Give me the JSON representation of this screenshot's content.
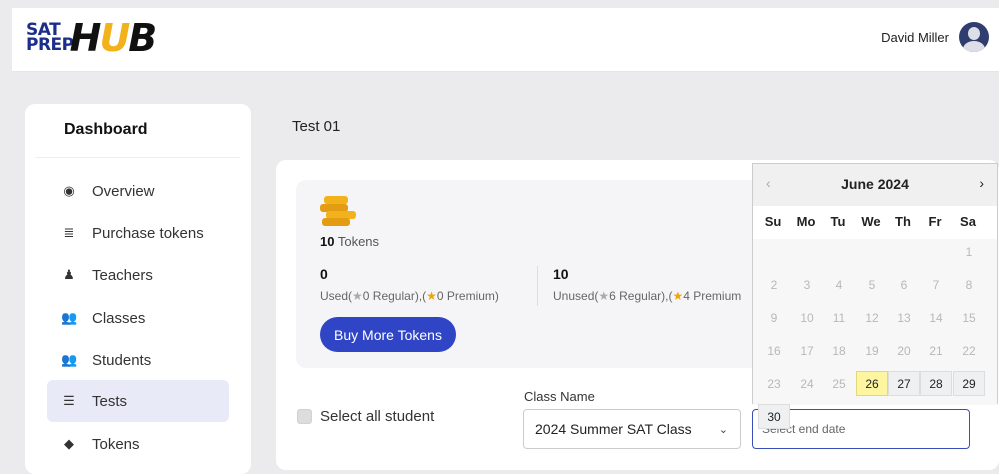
{
  "header": {
    "logo_sat": "SAT",
    "logo_prep": "PREP",
    "logo_h": "H",
    "logo_u": "U",
    "logo_b": "B",
    "user_name": "David Miller"
  },
  "sidebar": {
    "title": "Dashboard",
    "items": [
      {
        "label": "Overview",
        "icon": "eye-icon",
        "glyph": "◉"
      },
      {
        "label": "Purchase tokens",
        "icon": "coins-icon",
        "glyph": "≣"
      },
      {
        "label": "Teachers",
        "icon": "teacher-icon",
        "glyph": "♟"
      },
      {
        "label": "Classes",
        "icon": "users-icon",
        "glyph": "👥"
      },
      {
        "label": "Students",
        "icon": "users-icon",
        "glyph": "👥"
      },
      {
        "label": "Tests",
        "icon": "list-icon",
        "glyph": "☰"
      },
      {
        "label": "Tokens",
        "icon": "tag-icon",
        "glyph": "◆"
      }
    ],
    "active_index": 5
  },
  "breadcrumb": "Test 01",
  "tokens": {
    "count": "10",
    "count_label": " Tokens",
    "used_value": "0",
    "used_prefix": "Used(",
    "used_regular": "0 Regular),(",
    "used_premium": "0 Premium)",
    "unused_value": "10",
    "unused_prefix": "Unused(",
    "unused_regular": "6 Regular),(",
    "unused_premium": "4 Premium",
    "buy_label": "Buy More Tokens"
  },
  "form": {
    "select_all_label": "Select all student",
    "class_label": "Class Name",
    "class_value": "2024 Summer SAT Class",
    "date_placeholder": "Select end date"
  },
  "calendar": {
    "month_title": "June 2024",
    "prev": "‹",
    "next": "›",
    "weekdays": [
      "Su",
      "Mo",
      "Tu",
      "We",
      "Th",
      "Fr",
      "Sa"
    ],
    "days": [
      "1",
      "2",
      "3",
      "4",
      "5",
      "6",
      "7",
      "8",
      "9",
      "10",
      "11",
      "12",
      "13",
      "14",
      "15",
      "16",
      "17",
      "18",
      "19",
      "20",
      "21",
      "22",
      "23",
      "24",
      "25",
      "26",
      "27",
      "28",
      "29",
      "30"
    ],
    "today": "26",
    "first_enabled": "26",
    "first_weekday_index": 6
  },
  "colors": {
    "accent": "#2f45c6",
    "logo_blue": "#1c2e8c",
    "logo_yellow": "#f2b21c",
    "today_highlight": "#fdf5a0"
  }
}
